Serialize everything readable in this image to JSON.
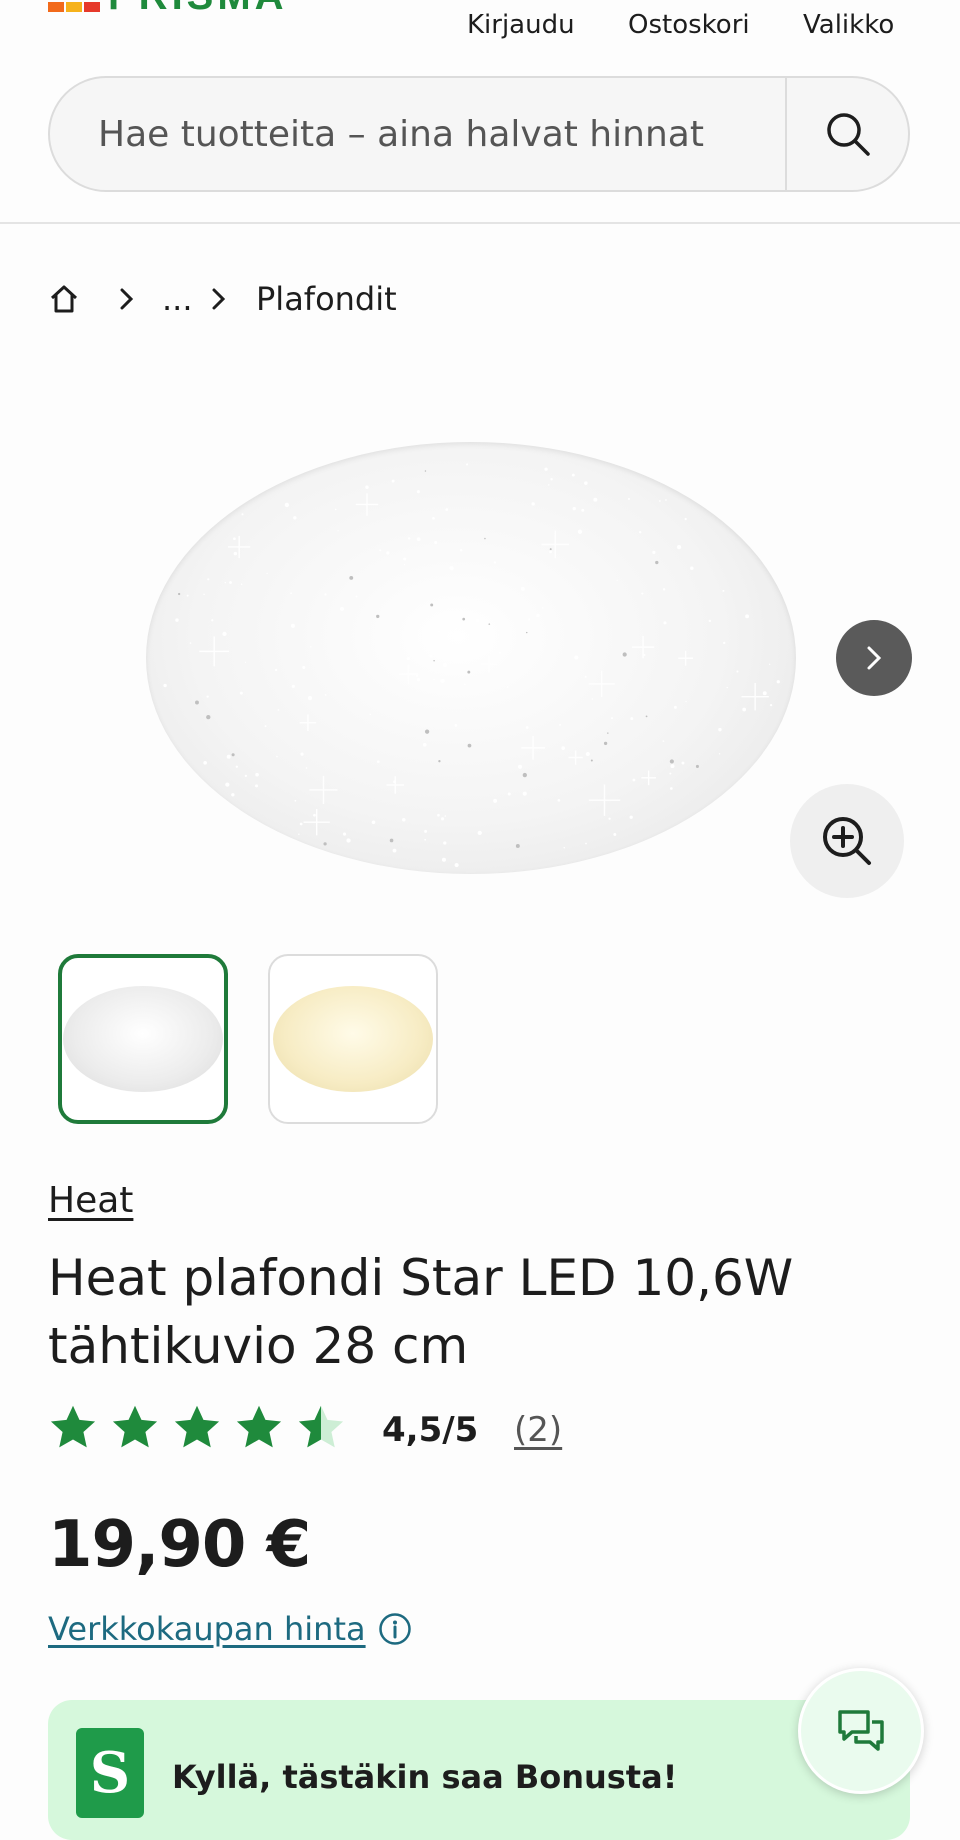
{
  "header": {
    "logo_text": "PRISMA",
    "nav": {
      "login": "Kirjaudu",
      "cart": "Ostoskori",
      "menu": "Valikko"
    },
    "search": {
      "placeholder": "Hae tuotteita – aina halvat hinnat"
    }
  },
  "breadcrumb": {
    "ellipsis": "...",
    "current": "Plafondit"
  },
  "gallery": {
    "selected_index": 0,
    "thumbnails": [
      "white",
      "warm"
    ]
  },
  "product": {
    "brand": "Heat",
    "title": "Heat plafondi Star LED 10,6W tähtikuvio 28 cm",
    "rating": {
      "value": 4.5,
      "max": 5,
      "text": "4,5/5",
      "reviews": "(2)"
    },
    "price": "19,90 €",
    "price_note": "Verkkokaupan hinta"
  },
  "bonus_banner": {
    "text": "Kyllä, tästäkin saa Bonusta!"
  },
  "colors": {
    "accent_green": "#1f7a3a",
    "star_green": "#1f8a3c",
    "link_teal": "#1d6a80",
    "bonus_bg": "#d6f8dc"
  },
  "icons": [
    "home-icon",
    "chevron-right-icon",
    "search-icon",
    "zoom-in-icon",
    "info-icon",
    "chat-icon",
    "star-icon"
  ]
}
